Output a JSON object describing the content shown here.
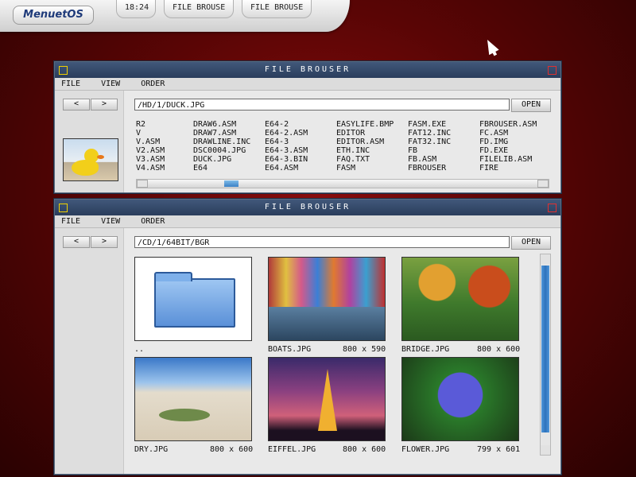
{
  "topbar": {
    "logo": "MenuetOS",
    "clock": "18:24",
    "task1": "FILE BROUSE",
    "task2": "FILE BROUSE"
  },
  "window1": {
    "title": "FILE BROUSER",
    "menu": [
      "FILE",
      "VIEW",
      "ORDER"
    ],
    "back": "<",
    "forward": ">",
    "path": "/HD/1/DUCK.JPG",
    "open": "OPEN",
    "columns": [
      [
        "R2",
        "V",
        "V.ASM",
        "V2.ASM",
        "V3.ASM",
        "V4.ASM"
      ],
      [
        "DRAW6.ASM",
        "DRAW7.ASM",
        "DRAWLINE.INC",
        "DSC0004.JPG",
        "DUCK.JPG",
        "E64"
      ],
      [
        "E64-2",
        "E64-2.ASM",
        "E64-3",
        "E64-3.ASM",
        "E64-3.BIN",
        "E64.ASM"
      ],
      [
        "EASYLIFE.BMP",
        "EDITOR",
        "EDITOR.ASM",
        "ETH.INC",
        "FAQ.TXT",
        "FASM"
      ],
      [
        "FASM.EXE",
        "FAT12.INC",
        "FAT32.INC",
        "FB",
        "FB.ASM",
        "FBROUSER"
      ],
      [
        "FBROUSER.ASM",
        "FC.ASM",
        "FD.IMG",
        "FD.EXE",
        "FILELIB.ASM",
        "FIRE"
      ]
    ]
  },
  "window2": {
    "title": "FILE BROUSER",
    "menu": [
      "FILE",
      "VIEW",
      "ORDER"
    ],
    "back": "<",
    "forward": ">",
    "path": "/CD/1/64BIT/BGR",
    "open": "OPEN",
    "items": [
      {
        "name": "..",
        "size": ""
      },
      {
        "name": "BOATS.JPG",
        "size": "800 x 590"
      },
      {
        "name": "BRIDGE.JPG",
        "size": "800 x 600"
      },
      {
        "name": "DRY.JPG",
        "size": "800 x 600"
      },
      {
        "name": "EIFFEL.JPG",
        "size": "800 x 600"
      },
      {
        "name": "FLOWER.JPG",
        "size": "799 x 601"
      }
    ]
  }
}
